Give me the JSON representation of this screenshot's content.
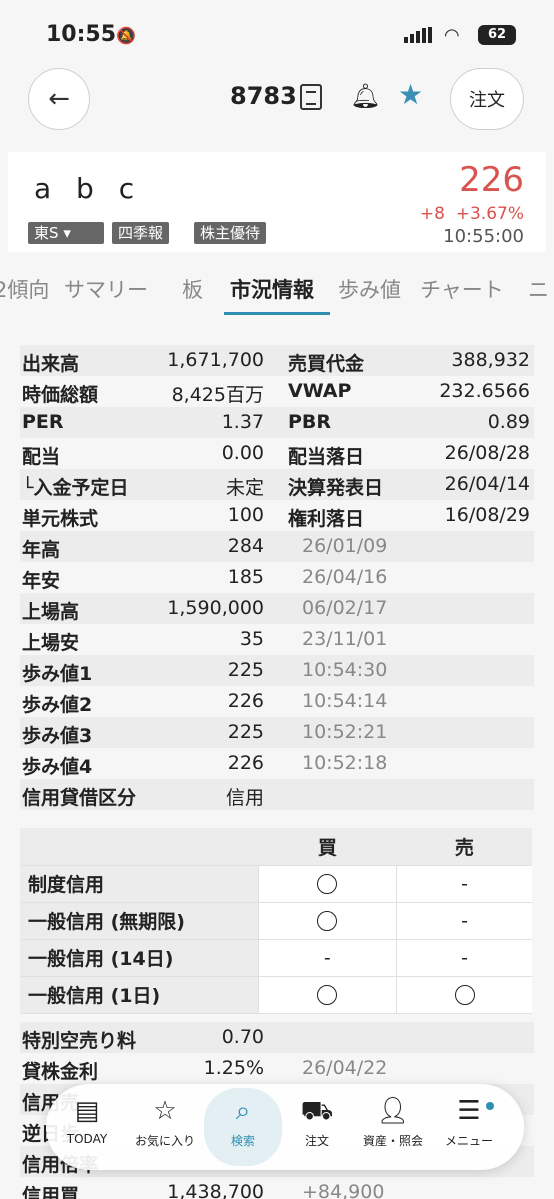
{
  "status": {
    "time": "10:55",
    "battery": "62"
  },
  "header": {
    "code": "8783",
    "order_label": "注文"
  },
  "quote": {
    "name": "a b c",
    "market": "東S",
    "tag1": "四季報",
    "tag2": "株主優待",
    "price": "226",
    "change": "+8",
    "change_pct": "+3.67%",
    "time": "10:55:00"
  },
  "tabs": [
    "2傾向",
    "サマリー",
    "板",
    "市況情報",
    "歩み値",
    "チャート",
    "ニ"
  ],
  "info": [
    {
      "l1": "出来高",
      "v1": "1,671,700",
      "l2": "売買代金",
      "v2": "388,932"
    },
    {
      "l1": "時価総額",
      "v1": "8,425百万",
      "l2": "VWAP",
      "v2": "232.6566"
    },
    {
      "l1": "PER",
      "v1": "1.37",
      "l2": "PBR",
      "v2": "0.89"
    },
    {
      "l1": "配当",
      "v1": "0.00",
      "l2": "配当落日",
      "v2": "26/08/28"
    },
    {
      "l1": "└入金予定日",
      "v1": "未定",
      "l2": "決算発表日",
      "v2": "26/04/14"
    },
    {
      "l1": "単元株式",
      "v1": "100",
      "l2": "権利落日",
      "v2": "16/08/29"
    },
    {
      "l1": "年高",
      "v1": "284",
      "d2": "26/01/09"
    },
    {
      "l1": "年安",
      "v1": "185",
      "d2": "26/04/16"
    },
    {
      "l1": "上場高",
      "v1": "1,590,000",
      "d2": "06/02/17"
    },
    {
      "l1": "上場安",
      "v1": "35",
      "d2": "23/11/01"
    },
    {
      "l1": "歩み値1",
      "v1": "225",
      "d2": "10:54:30"
    },
    {
      "l1": "歩み値2",
      "v1": "226",
      "d2": "10:54:14"
    },
    {
      "l1": "歩み値3",
      "v1": "225",
      "d2": "10:52:21"
    },
    {
      "l1": "歩み値4",
      "v1": "226",
      "d2": "10:52:18"
    },
    {
      "l1": "信用貸借区分",
      "v1": "信用"
    }
  ],
  "margin": {
    "col_buy": "買",
    "col_sell": "売",
    "rows": [
      {
        "label": "制度信用",
        "buy": "circle",
        "sell": "-"
      },
      {
        "label": "一般信用 (無期限)",
        "buy": "circle",
        "sell": "-"
      },
      {
        "label": "一般信用 (14日)",
        "buy": "-",
        "sell": "-"
      },
      {
        "label": "一般信用 (1日)",
        "buy": "circle",
        "sell": "circle"
      }
    ]
  },
  "extra": [
    {
      "l1": "特別空売り料",
      "v1": "0.70"
    },
    {
      "l1": "貸株金利",
      "v1": "1.25%",
      "d2": "26/04/22"
    },
    {
      "l1": "信用売",
      "v1": "",
      "d2": ""
    },
    {
      "l1": "逆日歩",
      "v1": "",
      "d2": ""
    },
    {
      "l1": "信用倍率",
      "v1": "",
      "d2": ""
    },
    {
      "l1": "信用買",
      "v1": "1,438,700",
      "d2": "+84,900"
    }
  ],
  "nav": [
    {
      "label": "TODAY",
      "icon": "today-icon"
    },
    {
      "label": "お気に入り",
      "icon": "star-icon"
    },
    {
      "label": "検索",
      "icon": "search-icon"
    },
    {
      "label": "注文",
      "icon": "cart-icon"
    },
    {
      "label": "資産・照会",
      "icon": "person-icon"
    },
    {
      "label": "メニュー",
      "icon": "menu-icon"
    }
  ]
}
